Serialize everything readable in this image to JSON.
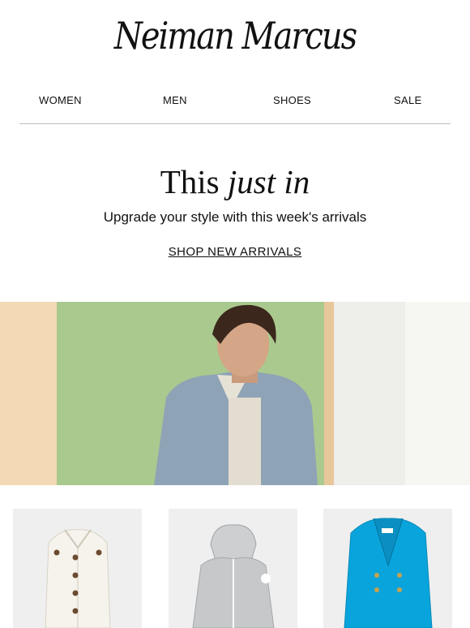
{
  "brand": {
    "logo_text": "Neiman Marcus"
  },
  "nav": {
    "items": [
      "WOMEN",
      "MEN",
      "SHOES",
      "SALE"
    ]
  },
  "promo": {
    "headline_roman": "This",
    "headline_italic": "just in",
    "subheadline": "Upgrade your style with this week's arrivals",
    "cta_label": "SHOP NEW ARRIVALS"
  },
  "products": [
    {
      "icon": "white-jacket-image",
      "color": "#f4f1ea"
    },
    {
      "icon": "gray-hooded-jacket-image",
      "color": "#c9cbcd"
    },
    {
      "icon": "blue-blazer-image",
      "color": "#0aa4dc"
    }
  ],
  "colors": {
    "text": "#111111",
    "divider": "#bdbdbd",
    "tile_bg": "#efefef"
  }
}
